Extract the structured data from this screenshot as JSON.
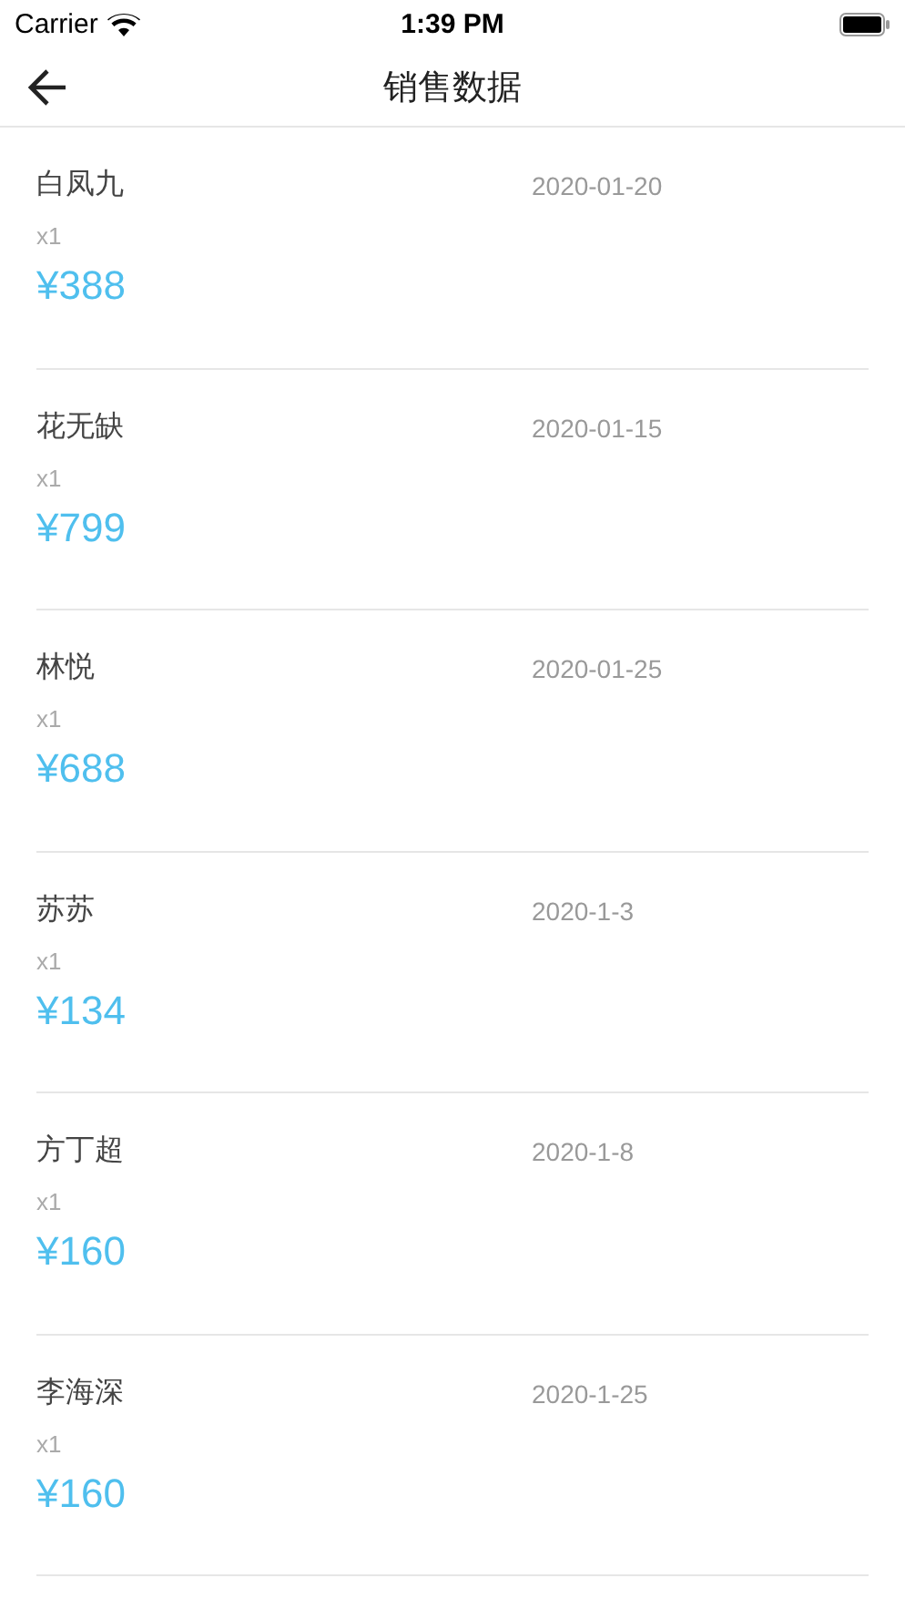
{
  "status_bar": {
    "carrier": "Carrier",
    "time": "1:39 PM"
  },
  "nav": {
    "title": "销售数据"
  },
  "sales": [
    {
      "name": "白凤九",
      "date": "2020-01-20",
      "quantity": "x1",
      "price": "¥388"
    },
    {
      "name": "花无缺",
      "date": "2020-01-15",
      "quantity": "x1",
      "price": "¥799"
    },
    {
      "name": "林悦",
      "date": "2020-01-25",
      "quantity": "x1",
      "price": "¥688"
    },
    {
      "name": "苏苏",
      "date": "2020-1-3",
      "quantity": "x1",
      "price": "¥134"
    },
    {
      "name": "方丁超",
      "date": "2020-1-8",
      "quantity": "x1",
      "price": "¥160"
    },
    {
      "name": "李海深",
      "date": "2020-1-25",
      "quantity": "x1",
      "price": "¥160"
    }
  ]
}
